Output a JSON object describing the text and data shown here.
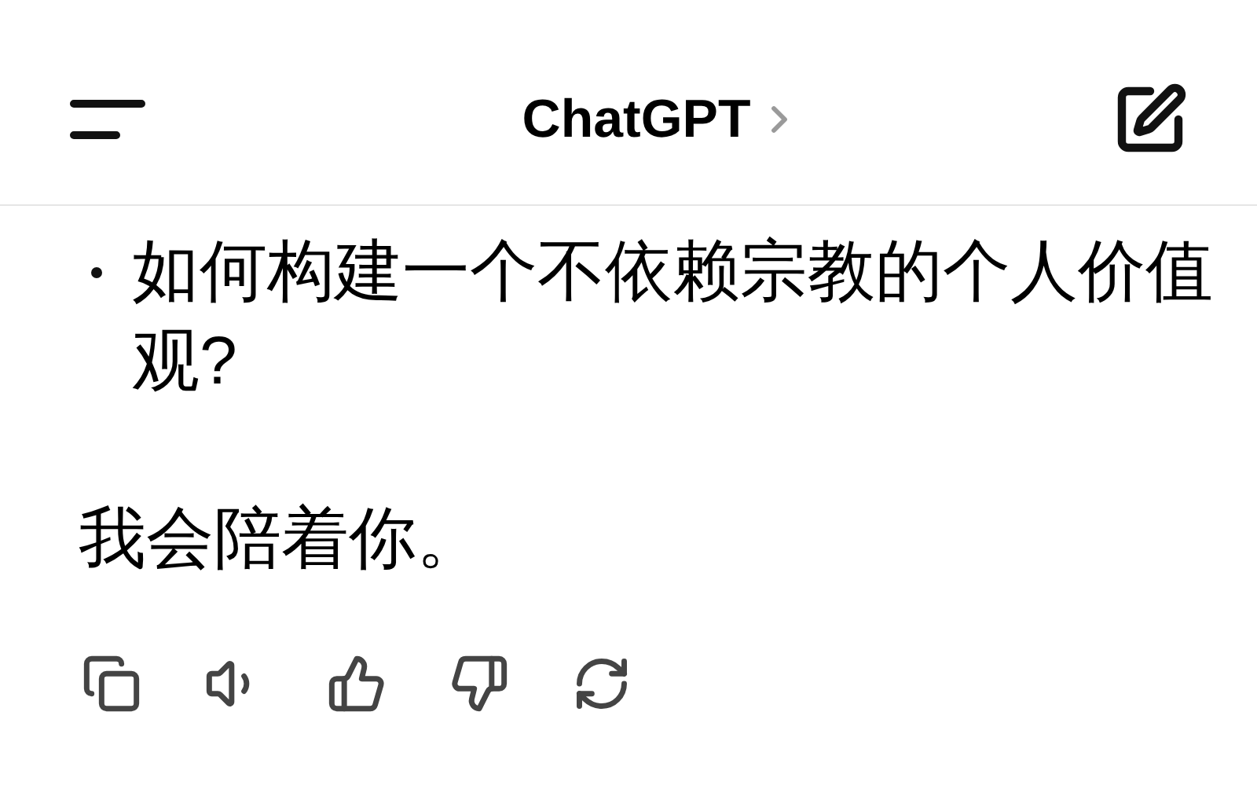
{
  "header": {
    "title": "ChatGPT"
  },
  "message": {
    "bullets": [
      "如何构建一个不依赖宗教的个人价值观?"
    ],
    "paragraph": "我会陪着你。"
  }
}
